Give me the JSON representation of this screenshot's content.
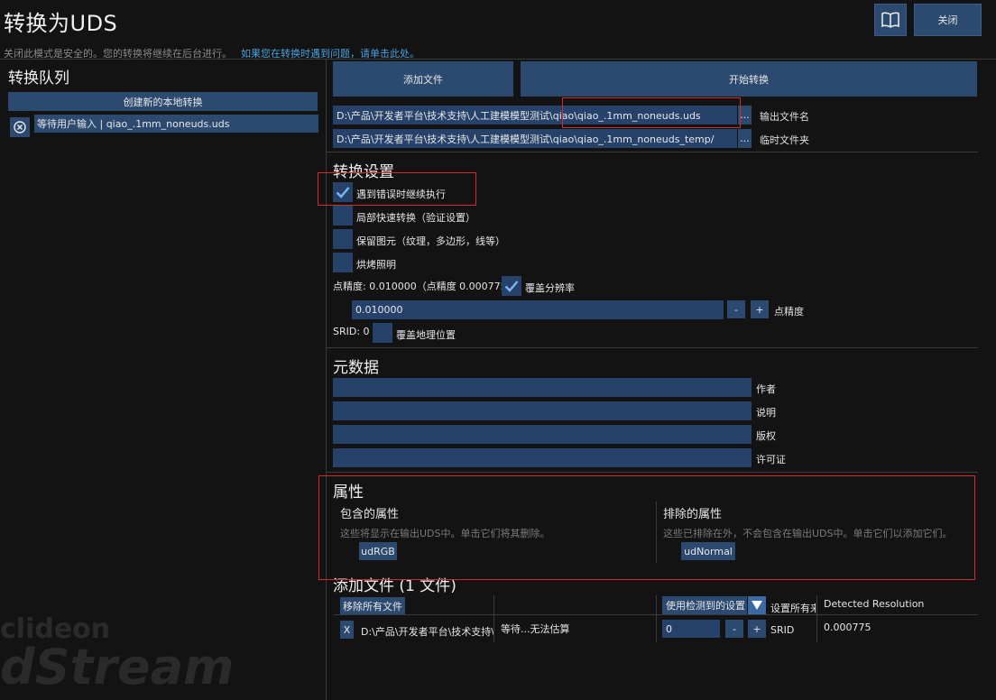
{
  "window": {
    "title": "转换为UDS",
    "subtitle": "关闭此模式是安全的。您的转换将继续在后台进行。",
    "help_link": "如果您在转换时遇到问题，请单击此处。",
    "close_label": "关闭",
    "book_icon": "book-icon"
  },
  "queue": {
    "title": "转换队列",
    "new_button": "创建新的本地转换",
    "items": [
      {
        "label": "等待用户输入 | qiao_.1mm_noneuds.uds",
        "icon": "cancel-circle-icon"
      }
    ]
  },
  "toolbar": {
    "add_files": "添加文件",
    "start_convert": "开始转换"
  },
  "output": {
    "output_path": "D:\\产品\\开发者平台\\技术支持\\人工建模模型测试\\qiao\\qiao_.1mm_noneuds.uds",
    "output_label": "输出文件名",
    "temp_path": "D:\\产品\\开发者平台\\技术支持\\人工建模模型测试\\qiao\\qiao_.1mm_noneuds_temp/",
    "temp_label": "临时文件夹",
    "browse": "..."
  },
  "settings": {
    "title": "转换设置",
    "continue_on_error": {
      "label": "遇到错误时继续执行",
      "checked": true
    },
    "quick_convert": {
      "label": "局部快速转换（验证设置）",
      "checked": false
    },
    "keep_primitives": {
      "label": "保留图元（纹理，多边形，线等）",
      "checked": false
    },
    "bake_lighting": {
      "label": "烘烤照明",
      "checked": false
    },
    "point_precision_text": "点精度: 0.010000（点精度 0.000775）",
    "override_resolution": {
      "label": "覆盖分辨率",
      "checked": true
    },
    "precision_value": "0.010000",
    "precision_label": "点精度",
    "minus": "-",
    "plus": "+",
    "srid_text": "SRID: 0",
    "override_geo": {
      "label": "覆盖地理位置",
      "checked": false
    }
  },
  "metadata": {
    "title": "元数据",
    "author_label": "作者",
    "desc_label": "说明",
    "copyright_label": "版权",
    "license_label": "许可证"
  },
  "attributes": {
    "title": "属性",
    "included_title": "包含的属性",
    "included_desc": "这些将显示在输出UDS中。单击它们将其删除。",
    "included": [
      "udRGB"
    ],
    "excluded_title": "排除的属性",
    "excluded_desc": "这些已排除在外，不会包含在输出UDS中。单击它们以添加它们。",
    "excluded": [
      "udNormal"
    ]
  },
  "files": {
    "title": "添加文件 (1 文件)",
    "remove_all": "移除所有文件",
    "use_detected": "使用检测到的设置",
    "set_all": "设置所有来",
    "detected_res_header": "Detected Resolution",
    "rows": [
      {
        "remove": "X",
        "path": "D:\\产品\\开发者平台\\技术支持\\",
        "status": "等待...无法估算",
        "srid_value": "0",
        "srid_label": "SRID",
        "resolution": "0.000775"
      }
    ]
  },
  "watermark": {
    "line1": "clideon",
    "line2": "dStream"
  },
  "colors": {
    "background": "#131313",
    "button": "#2c4a70",
    "field": "#26426a",
    "highlight": "#d62a2a",
    "link": "#4aa3df"
  }
}
